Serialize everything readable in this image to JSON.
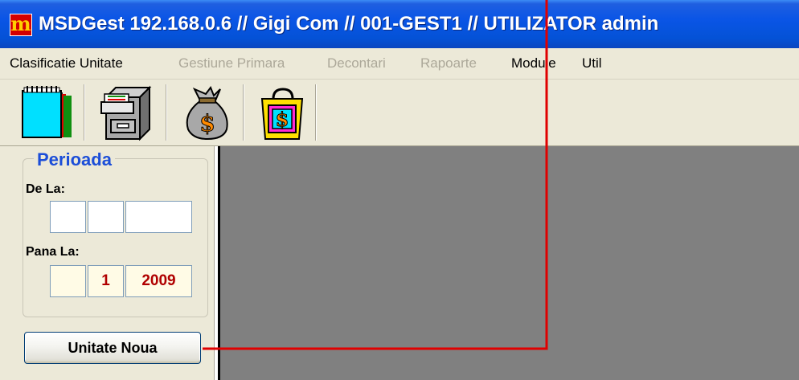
{
  "window": {
    "title": "MSDGest 192.168.0.6 // Gigi Com // 001-GEST1 // UTILIZATOR admin",
    "icon_letter": "m",
    "icon": "app-logo-icon"
  },
  "menu": [
    {
      "label": "Clasificatie Unitate",
      "enabled": true
    },
    {
      "label": "Gestiune Primara",
      "enabled": false
    },
    {
      "label": "Decontari",
      "enabled": false
    },
    {
      "label": "Rapoarte",
      "enabled": false
    },
    {
      "label": "Module",
      "enabled": true
    },
    {
      "label": "Util",
      "enabled": true
    }
  ],
  "toolbar": {
    "buttons": [
      {
        "icon": "notebook-icon"
      },
      {
        "icon": "filing-cabinet-icon"
      },
      {
        "icon": "money-bag-icon"
      },
      {
        "icon": "shopping-bag-dollar-icon"
      }
    ]
  },
  "period": {
    "legend": "Perioada",
    "from_label": "De La:",
    "from": {
      "day": "",
      "month": "",
      "year": ""
    },
    "to_label": "Pana La:",
    "to": {
      "day": "",
      "month": "1",
      "year": "2009"
    }
  },
  "new_unit_button": "Unitate Noua",
  "colors": {
    "title_bar": "#0452d6",
    "legend_text": "#1c4ed8",
    "date_text": "#b00000",
    "workspace": "#808080",
    "annotation_line": "#e00000"
  }
}
